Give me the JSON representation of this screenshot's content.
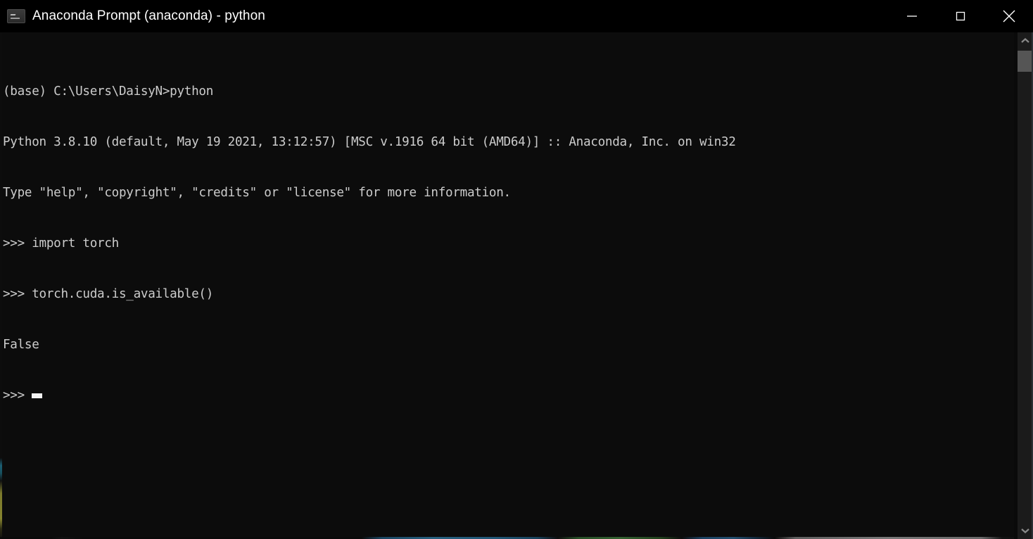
{
  "window": {
    "title": "Anaconda Prompt (anaconda) - python",
    "icon": "console-icon",
    "background": "#0c0c0c",
    "titlebar_background": "#000000",
    "text_color": "#cccccc"
  },
  "titlebar": {
    "minimize_label": "Minimize",
    "maximize_label": "Maximize",
    "close_label": "Close"
  },
  "terminal": {
    "lines": [
      "(base) C:\\Users\\DaisyN>python",
      "Python 3.8.10 (default, May 19 2021, 13:12:57) [MSC v.1916 64 bit (AMD64)] :: Anaconda, Inc. on win32",
      "Type \"help\", \"copyright\", \"credits\" or \"license\" for more information.",
      ">>> import torch",
      ">>> torch.cuda.is_available()",
      "False"
    ],
    "prompt": ">>> ",
    "cursor": "block-cursor"
  },
  "scrollbar": {
    "up_arrow": "chevron-up-icon",
    "down_arrow": "chevron-down-icon",
    "thumb_color": "#555555",
    "track_color": "#1b1b1b"
  }
}
